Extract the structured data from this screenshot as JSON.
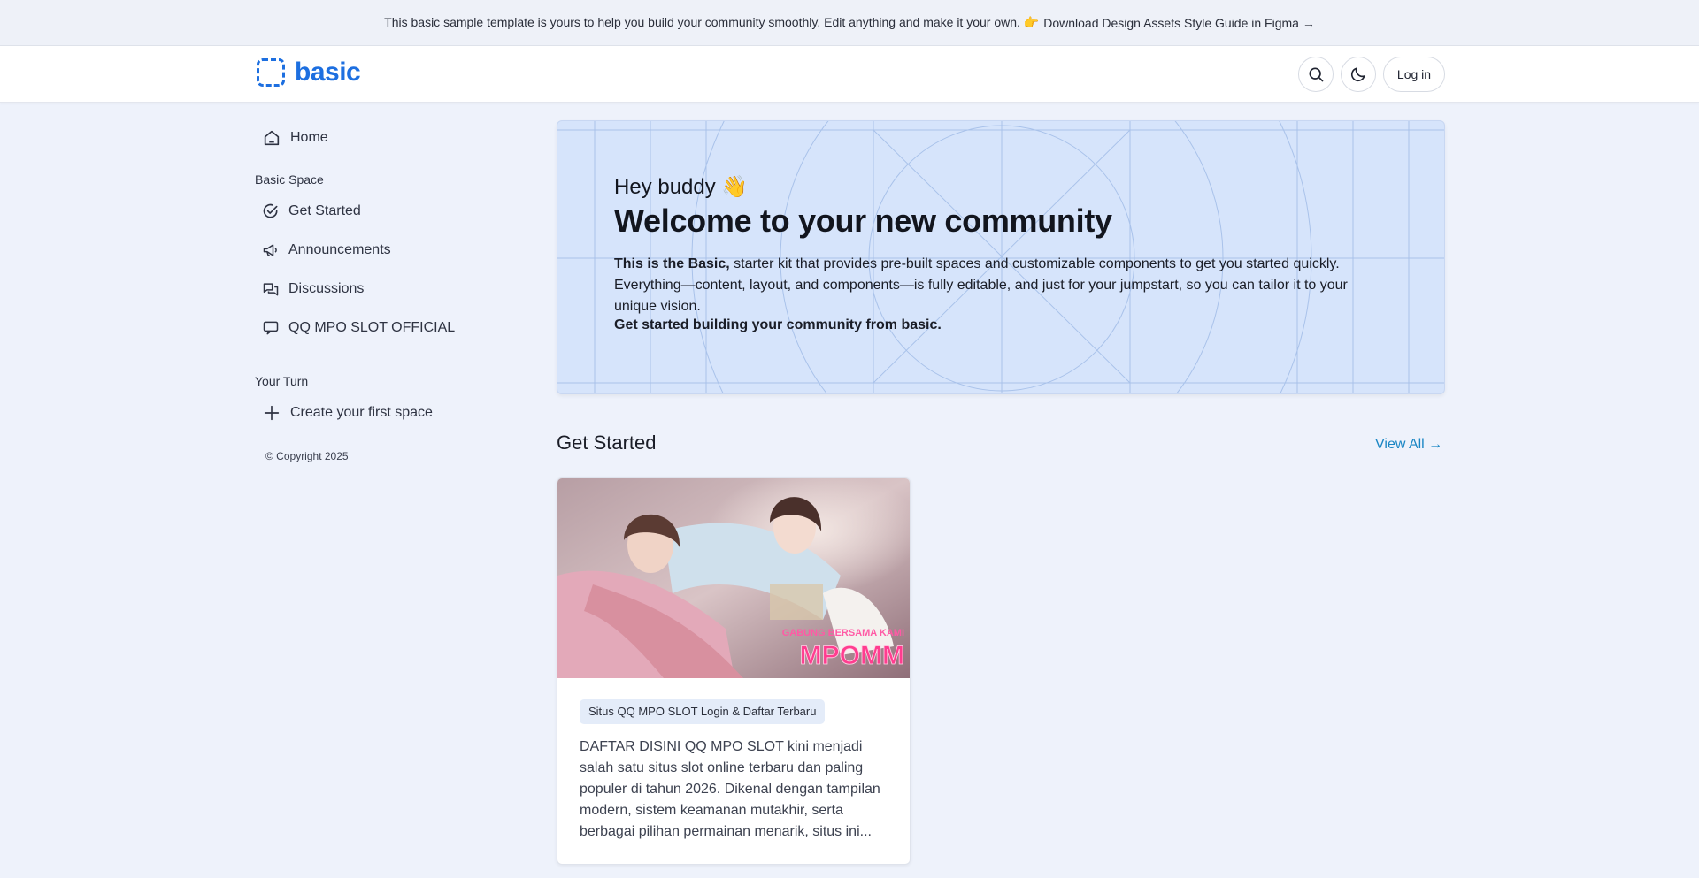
{
  "banner": {
    "text": "This basic sample template is yours to help you build your community smoothly. Edit anything and make it your own. 👉",
    "link": "Download Design Assets Style Guide in Figma →"
  },
  "header": {
    "logo_text": "basic",
    "login_label": "Log in",
    "brand_color": "#1d6fe0"
  },
  "sidebar": {
    "home": "Home",
    "section1_title": "Basic Space",
    "items": [
      {
        "label": "Get Started",
        "icon": "check-circle-icon"
      },
      {
        "label": "Announcements",
        "icon": "megaphone-icon"
      },
      {
        "label": "Discussions",
        "icon": "chat-bubbles-icon"
      },
      {
        "label": "QQ MPO SLOT OFFICIAL",
        "icon": "chat-icon"
      }
    ],
    "section2_title": "Your Turn",
    "create_label": "Create your first space",
    "copyright": "© Copyright 2025"
  },
  "hero": {
    "greeting": "Hey buddy 👋",
    "title": "Welcome to your new community",
    "desc_bold": "This is the Basic,",
    "desc_rest": " starter kit that provides pre-built spaces and customizable components to get you started quickly. Everything—content, layout, and components—is fully editable, and just for your jumpstart, so you can tailor it to your unique vision.",
    "cta": "Get started building your community from basic.",
    "bg_color": "#d6e4fb"
  },
  "get_started": {
    "heading": "Get Started",
    "view_all": "View All →",
    "link_color": "#1a86c4"
  },
  "card": {
    "image_caption_small": "GABUNG BERSAMA KAMI",
    "image_caption_big": "MPOMM",
    "tag": "Situs QQ MPO SLOT Login & Daftar Terbaru",
    "text": "DAFTAR DISINI QQ MPO SLOT kini menjadi salah satu situs slot online terbaru dan paling populer di tahun 2026. Dikenal dengan tampilan modern, sistem keamanan mutakhir, serta berbagai pilihan permainan menarik, situs ini..."
  }
}
